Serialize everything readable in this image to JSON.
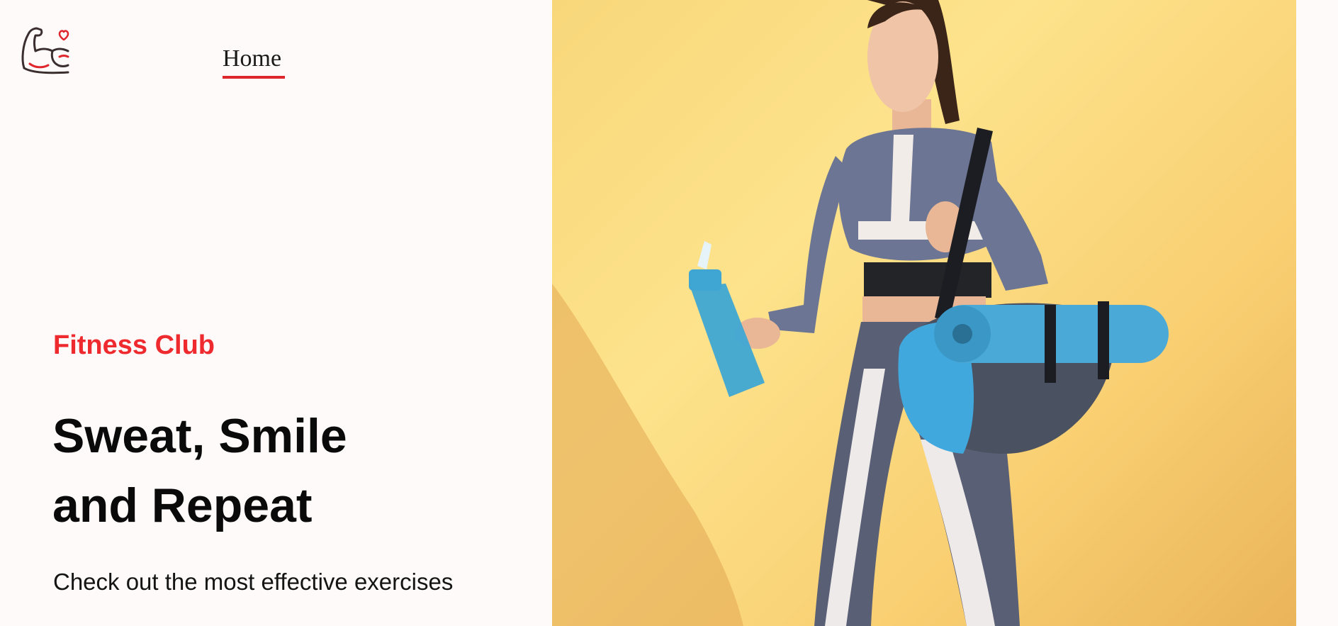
{
  "brand": {
    "logo_icon": "flexed-arm-heart-icon",
    "logo_stroke_color": "#3a2e2e",
    "logo_accent_color": "#e0262d"
  },
  "nav": {
    "items": [
      {
        "label": "Home",
        "active": true
      }
    ],
    "active_underline_color": "#e0262d"
  },
  "hero": {
    "eyebrow": "Fitness Club",
    "eyebrow_color": "#ee2a2f",
    "headline_line1": "Sweat, Smile",
    "headline_line2": "and Repeat",
    "subtext": "Check out the most effective exercises",
    "image": {
      "icon": "woman-with-gym-bag-photo",
      "background_color": "#fbd97e"
    }
  }
}
